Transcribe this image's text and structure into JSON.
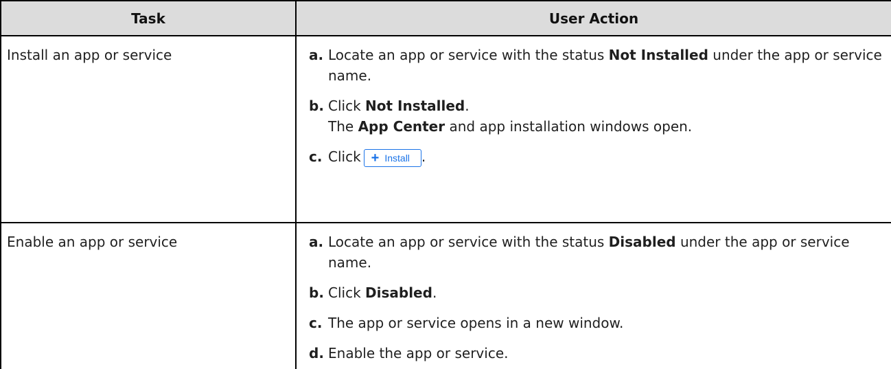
{
  "headers": {
    "task": "Task",
    "user_action": "User Action"
  },
  "rows": [
    {
      "task": "Install an app or service",
      "steps": [
        {
          "letter": "a.",
          "t1": "Locate an app or service with the status ",
          "b1": "Not Installed",
          "t2": " under the app or service name."
        },
        {
          "letter": "b.",
          "t1": "Click ",
          "b1": "Not Installed",
          "t2": ".",
          "t3": "The ",
          "b2": "App Center",
          "t4": " and app installation windows open."
        },
        {
          "letter": "c.",
          "t1": "Click",
          "button_label": "Install",
          "button_icon": "plus-icon",
          "t2": "."
        }
      ]
    },
    {
      "task": "Enable an app or service",
      "steps": [
        {
          "letter": "a.",
          "t1": "Locate an app or service with the status ",
          "b1": "Disabled",
          "t2": " under the app or service name."
        },
        {
          "letter": "b.",
          "t1": "Click ",
          "b1": "Disabled",
          "t2": "."
        },
        {
          "letter": "c.",
          "t1": "The app or service opens in a new window."
        },
        {
          "letter": "d.",
          "t1": "Enable the app or service."
        }
      ]
    }
  ],
  "colors": {
    "header_bg": "#dcdcdc",
    "border": "#000000",
    "accent": "#1a73e8"
  }
}
